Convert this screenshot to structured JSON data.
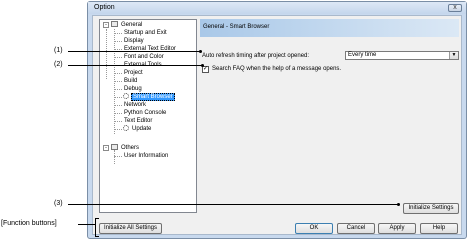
{
  "window": {
    "title": "Option",
    "close_glyph": "x"
  },
  "tree": {
    "general": "General",
    "general_items": [
      "Startup and Exit",
      "Display",
      "External Text Editor",
      "Font and Color",
      "External Tools",
      "Project",
      "Build",
      "Debug",
      "Smart Browser",
      "Network",
      "Python Console",
      "Text Editor",
      "Update"
    ],
    "selected": "Smart Browser",
    "others": "Others",
    "others_items": [
      "User Information"
    ],
    "expander_glyph": "-"
  },
  "panel": {
    "header": "General - Smart Browser",
    "auto_refresh_label": "Auto refresh timing after project opened:",
    "auto_refresh_value": "Every time",
    "search_faq_label": "Search FAQ when the help of a message opens.",
    "search_faq_checked": true,
    "check_glyph": "✓",
    "select_arrow_glyph": "▼"
  },
  "buttons": {
    "initialize_settings": "Initialize Settings",
    "initialize_all": "Initialize All Settings",
    "ok": "OK",
    "cancel": "Cancel",
    "apply": "Apply",
    "help": "Help"
  },
  "callouts": {
    "c1": "(1)",
    "c2": "(2)",
    "c3": "(3)",
    "function_buttons": "[Function buttons]"
  }
}
